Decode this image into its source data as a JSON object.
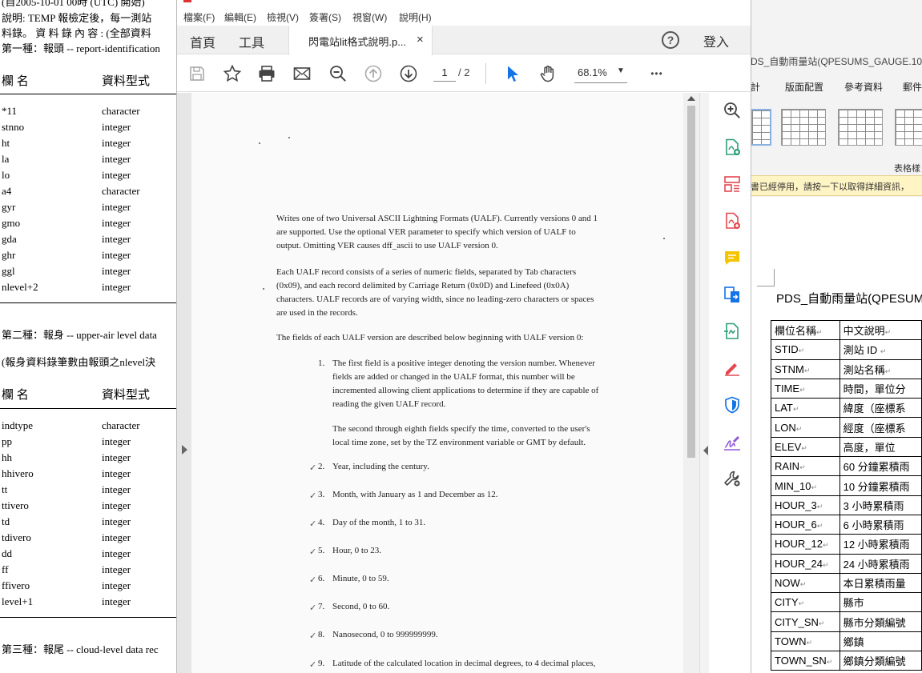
{
  "left_doc": {
    "top_lines": [
      "(自2005-10-01 00時 (UTC) 開始)",
      "說明: TEMP 報檢定後，每一測站",
      "料錄。 資 料 錄 內 容 : (全部資料",
      "第一種：報頭 -- report-identification"
    ],
    "table_header": {
      "name": "欄 名",
      "type": "資料型式"
    },
    "section1_rows": [
      {
        "name": "*11",
        "type": "character"
      },
      {
        "name": "stnno",
        "type": "integer"
      },
      {
        "name": "ht",
        "type": "integer"
      },
      {
        "name": "la",
        "type": "integer"
      },
      {
        "name": "lo",
        "type": "integer"
      },
      {
        "name": "a4",
        "type": "character"
      },
      {
        "name": "gyr",
        "type": "integer"
      },
      {
        "name": "gmo",
        "type": "integer"
      },
      {
        "name": "gda",
        "type": "integer"
      },
      {
        "name": "ghr",
        "type": "integer"
      },
      {
        "name": "ggl",
        "type": "integer"
      },
      {
        "name": "nlevel+2",
        "type": "integer"
      }
    ],
    "section2_title": "第二種：報身 -- upper-air level data",
    "section2_note": "(報身資料錄筆數由報頭之nlevel決",
    "section2_rows": [
      {
        "name": "indtype",
        "type": "character"
      },
      {
        "name": "pp",
        "type": "integer"
      },
      {
        "name": "hh",
        "type": "integer"
      },
      {
        "name": "hhivero",
        "type": "integer"
      },
      {
        "name": "tt",
        "type": "integer"
      },
      {
        "name": "ttivero",
        "type": "integer"
      },
      {
        "name": "td",
        "type": "integer"
      },
      {
        "name": "tdivero",
        "type": "integer"
      },
      {
        "name": "dd",
        "type": "integer"
      },
      {
        "name": "ff",
        "type": "integer"
      },
      {
        "name": "ffivero",
        "type": "integer"
      },
      {
        "name": "level+1",
        "type": "integer"
      }
    ],
    "section3_title": "第三種：報尾 -- cloud-level data rec"
  },
  "viewer": {
    "menu": [
      "檔案(F)",
      "編輯(E)",
      "檢視(V)",
      "簽署(S)",
      "視窗(W)",
      "說明(H)"
    ],
    "nav_tabs": [
      "首頁",
      "工具"
    ],
    "doc_tab_label": "閃電站lit格式說明.p...",
    "doc_tab_close": "×",
    "help_label": "?",
    "signin_label": "登入",
    "current_page": "1",
    "total_pages": "/ 2",
    "zoom": "68.1%",
    "more_label": "•••"
  },
  "pdf": {
    "para1": [
      "Writes one of two Universal ASCII Lightning Formats (UALF). Currently versions 0 and 1",
      "are supported. Use the optional VER parameter to specify which version of UALF to",
      "output. Omitting VER causes dff_ascii to use UALF version 0."
    ],
    "para2": [
      "Each UALF record consists of a series of numeric fields, separated by Tab characters",
      "(0x09), and each record delimited by Carriage Return (0x0D) and Linefeed (0x0A)",
      "characters. UALF records are of varying width, since no leading-zero characters or spaces",
      "are used in the records."
    ],
    "para3": "The fields of each UALF version are described below beginning with UALF version 0:",
    "item1": [
      "The first field is a positive integer denoting the version number. Whenever",
      "fields are added or changed in the UALF format, this number will be",
      "incremented allowing client applications to determine if they are capable of",
      "reading the given UALF record."
    ],
    "item1_note": [
      "The second through eighth fields specify the time, converted to the user's",
      "local time zone, set by the TZ environment variable or GMT by default."
    ],
    "items": [
      {
        "num": "1.",
        "text": ""
      },
      {
        "num": "2.",
        "text": "Year, including the century."
      },
      {
        "num": "3.",
        "text": "Month, with January as 1 and December as 12."
      },
      {
        "num": "4.",
        "text": "Day of the month, 1 to 31."
      },
      {
        "num": "5.",
        "text": "Hour, 0 to 23."
      },
      {
        "num": "6.",
        "text": "Minute, 0 to 59."
      },
      {
        "num": "7.",
        "text": "Second, 0 to 60."
      },
      {
        "num": "8.",
        "text": "Nanosecond, 0 to 999999999."
      },
      {
        "num": "9.",
        "text": "Latitude of the calculated location in decimal degrees, to 4 decimal places,"
      }
    ]
  },
  "right_doc": {
    "window_title": "DS_自動雨量站(QPESUMS_GAUGE.10M",
    "ribbon_tabs": [
      "計",
      "版面配置",
      "參考資料",
      "郵件"
    ],
    "group_label": "表格樣",
    "infobar_text": "書已經停用，請按一下以取得詳細資訊，",
    "doc_title": "PDS_自動雨量站(QPESUMS",
    "table_rows": [
      {
        "field": "欄位名稱",
        "desc": "中文說明"
      },
      {
        "field": "STID",
        "desc": "測站 ID "
      },
      {
        "field": "STNM",
        "desc": "測站名稱"
      },
      {
        "field": "TIME",
        "desc": "時間，單位分"
      },
      {
        "field": "LAT",
        "desc": "緯度（座標系"
      },
      {
        "field": "LON",
        "desc": "經度（座標系"
      },
      {
        "field": "ELEV",
        "desc": "高度，單位"
      },
      {
        "field": "RAIN",
        "desc": "60 分鐘累積雨"
      },
      {
        "field": "MIN_10",
        "desc": "10 分鐘累積雨"
      },
      {
        "field": "HOUR_3",
        "desc": "3 小時累積雨"
      },
      {
        "field": "HOUR_6",
        "desc": "6 小時累積雨"
      },
      {
        "field": "HOUR_12",
        "desc": "12 小時累積雨"
      },
      {
        "field": "HOUR_24",
        "desc": "24 小時累積雨"
      },
      {
        "field": "NOW",
        "desc": "本日累積雨量"
      },
      {
        "field": "CITY",
        "desc": "縣市"
      },
      {
        "field": "CITY_SN",
        "desc": "縣市分類編號"
      },
      {
        "field": "TOWN",
        "desc": "鄉鎮"
      },
      {
        "field": "TOWN_SN",
        "desc": "鄉鎮分類編號"
      }
    ]
  }
}
